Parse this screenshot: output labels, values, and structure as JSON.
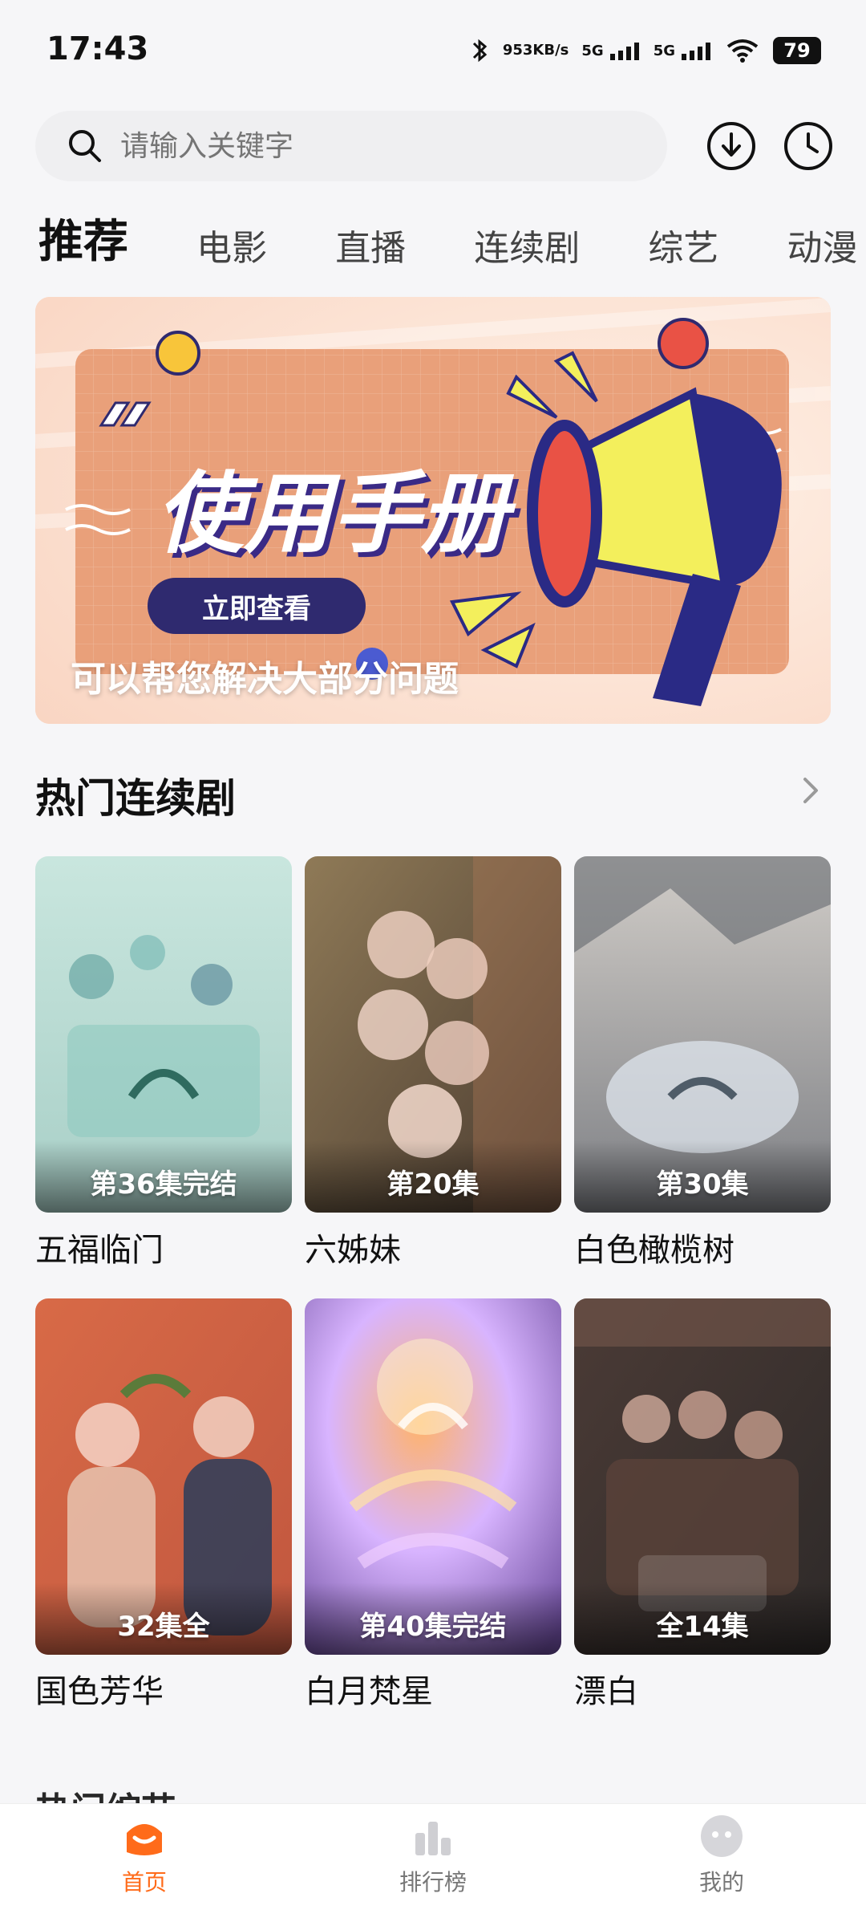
{
  "status_bar": {
    "time": "17:43",
    "speed_value": "953",
    "speed_unit": "KB/s",
    "signal_1": "5G",
    "signal_2": "5G",
    "battery": "79"
  },
  "search": {
    "placeholder": "请输入关键字"
  },
  "tabs": [
    "推荐",
    "电影",
    "直播",
    "连续剧",
    "综艺",
    "动漫"
  ],
  "banner": {
    "title": "使用手册",
    "button_label": "立即查看",
    "caption": "可以帮您解决大部分问题",
    "colors": {
      "background": "#f9d5c2",
      "board": "#e9a07a",
      "button": "#2f2a6f",
      "megaphone_yellow": "#f3ef5c",
      "megaphone_dark": "#2a2a85"
    }
  },
  "section": {
    "title": "热门连续剧"
  },
  "posters": [
    {
      "title": "五福临门",
      "badge": "第36集完结",
      "colors": [
        "#c9e6de",
        "#a8cfc7",
        "#6aa6a4"
      ]
    },
    {
      "title": "六姊妹",
      "badge": "第20集",
      "colors": [
        "#8f7a57",
        "#4a3b30",
        "#b47c5a"
      ]
    },
    {
      "title": "白色橄榄树",
      "badge": "第30集",
      "colors": [
        "#d1cdc8",
        "#7d7f84",
        "#5a5f66"
      ]
    },
    {
      "title": "国色芳华",
      "badge": "32集全",
      "colors": [
        "#d86a47",
        "#c1573f",
        "#2c3d5a"
      ]
    },
    {
      "title": "白月梵星",
      "badge": "第40集完结",
      "colors": [
        "#6b4b9c",
        "#d8b4ff",
        "#ffb36b"
      ]
    },
    {
      "title": "漂白",
      "badge": "全14集",
      "colors": [
        "#4b3b36",
        "#6c5247",
        "#2e2a29"
      ]
    }
  ],
  "next_section_peek": "热门综艺",
  "bottom_nav": [
    {
      "label": "首页",
      "active": true
    },
    {
      "label": "排行榜",
      "active": false
    },
    {
      "label": "我的",
      "active": false
    }
  ],
  "theme": {
    "accent": "#ff6b1a"
  }
}
